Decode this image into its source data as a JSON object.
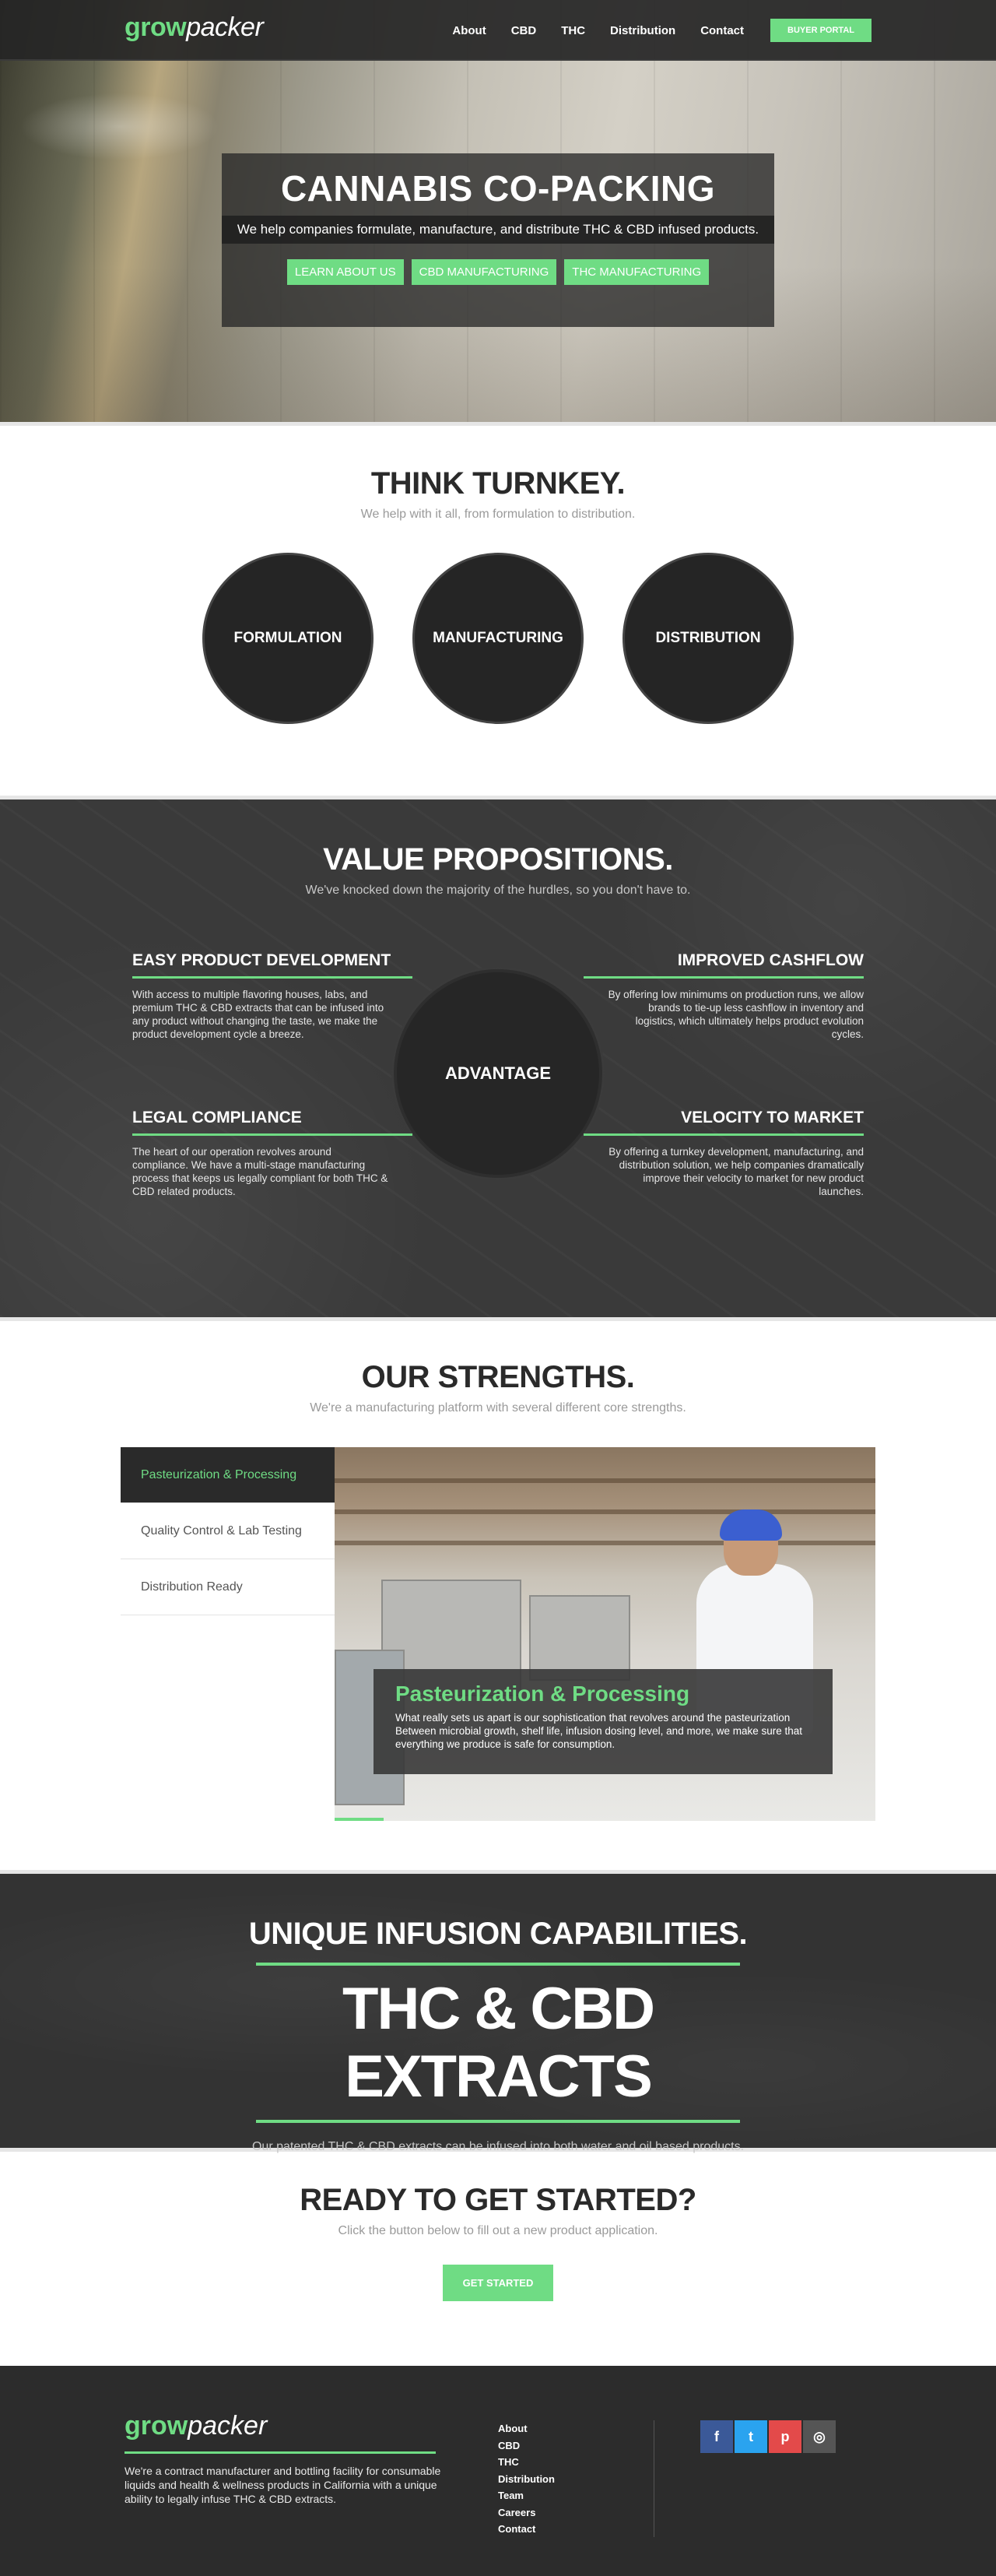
{
  "header": {
    "logo_grow": "grow",
    "logo_packer": "packer",
    "nav": [
      "About",
      "CBD",
      "THC",
      "Distribution",
      "Contact"
    ],
    "buyer_portal": "BUYER PORTAL"
  },
  "hero": {
    "title": "CANNABIS CO-PACKING",
    "subtitle": "We help companies formulate, manufacture, and distribute THC & CBD infused products.",
    "buttons": [
      "LEARN ABOUT US",
      "CBD MANUFACTURING",
      "THC MANUFACTURING"
    ]
  },
  "turnkey": {
    "title": "THINK TURNKEY.",
    "subtitle": "We help with it all, from formulation to distribution.",
    "circles": [
      "FORMULATION",
      "MANUFACTURING",
      "DISTRIBUTION"
    ]
  },
  "values": {
    "title": "VALUE PROPOSITIONS.",
    "subtitle": "We've knocked down the majority of the hurdles, so you don't have to.",
    "center": "ADVANTAGE",
    "items": [
      {
        "title": "EASY PRODUCT DEVELOPMENT",
        "text": "With access to multiple flavoring houses, labs, and premium THC & CBD extracts that can be infused into any product without changing the taste, we make the product development cycle a breeze."
      },
      {
        "title": "IMPROVED CASHFLOW",
        "text": "By offering low minimums on production runs, we allow brands to tie-up less cashflow in inventory and logistics, which ultimately helps product evolution cycles."
      },
      {
        "title": "LEGAL COMPLIANCE",
        "text": "The heart of our operation revolves around compliance. We have a multi-stage manufacturing process that keeps us legally compliant for both THC & CBD related products."
      },
      {
        "title": "VELOCITY TO MARKET",
        "text": "By offering a turnkey development, manufacturing, and distribution solution, we help companies dramatically improve their velocity to market for new product launches."
      }
    ]
  },
  "strengths": {
    "title": "OUR STRENGTHS.",
    "subtitle": "We're a manufacturing platform with several different core strengths.",
    "tabs": [
      "Pasteurization & Processing",
      "Quality Control & Lab Testing",
      "Distribution Ready"
    ],
    "caption_title": "Pasteurization & Processing",
    "caption_text": "What really sets us apart is our sophistication that revolves around the pasteurization Between microbial growth, shelf life, infusion dosing level, and more, we make sure that everything we produce is safe for consumption.",
    "slide_progress": 0.09
  },
  "infusion": {
    "title": "UNIQUE INFUSION CAPABILITIES.",
    "headline": "THC & CBD EXTRACTS",
    "subtitle": "Our patented THC & CBD extracts can be infused into both water and oil based products."
  },
  "ready": {
    "title": "READY TO GET STARTED?",
    "subtitle": "Click the button below to fill out a new product application.",
    "button": "GET STARTED"
  },
  "footer": {
    "logo_grow": "grow",
    "logo_packer": "packer",
    "description": "We're a contract manufacturer and bottling facility for consumable liquids and health & wellness products in California with a unique ability to legally infuse THC & CBD extracts.",
    "links": [
      "About",
      "CBD",
      "THC",
      "Distribution",
      "Team",
      "Careers",
      "Contact"
    ],
    "social": [
      {
        "name": "facebook-icon",
        "glyph": "f",
        "color": "#3b5998"
      },
      {
        "name": "twitter-icon",
        "glyph": "t",
        "color": "#2aa3ef"
      },
      {
        "name": "pinterest-icon",
        "glyph": "p",
        "color": "#e34a4a"
      },
      {
        "name": "instagram-icon",
        "glyph": "◎",
        "color": "#555555"
      }
    ]
  },
  "colors": {
    "accent": "#6fdc84",
    "dark": "#252525"
  }
}
